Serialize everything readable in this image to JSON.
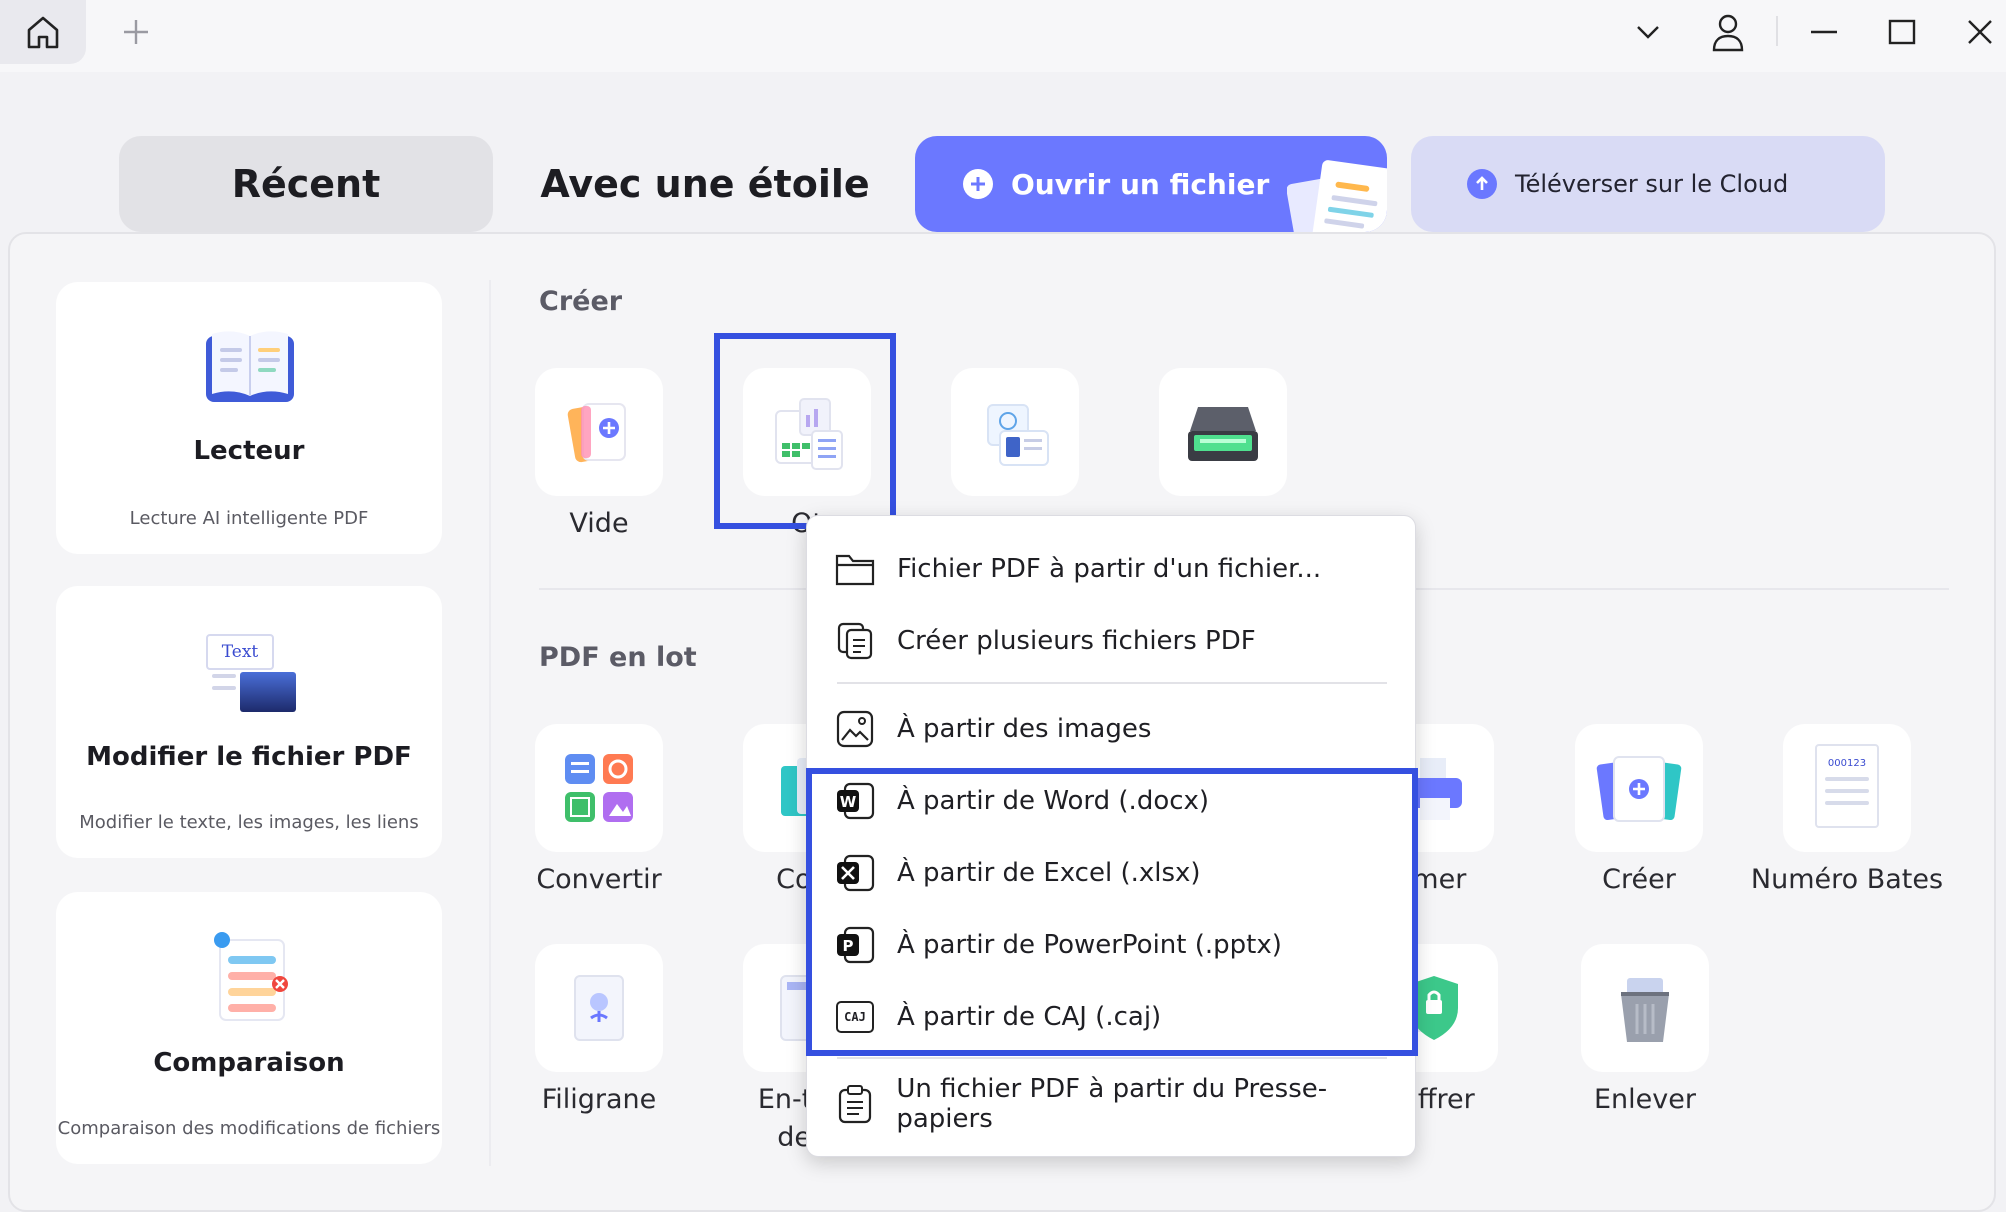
{
  "tabs": {
    "recent": "Récent",
    "starred": "Avec une étoile",
    "open_file": "Ouvrir un fichier",
    "upload_cloud": "Téléverser sur le Cloud"
  },
  "cards": [
    {
      "title": "Lecteur",
      "subtitle": "Lecture AI intelligente PDF"
    },
    {
      "title": "Modifier le fichier PDF",
      "subtitle": "Modifier le texte, les images, les liens"
    },
    {
      "title": "Comparaison",
      "subtitle": "Comparaison des modifications de fichiers"
    }
  ],
  "sections": {
    "create": "Créer",
    "batch": "PDF en lot"
  },
  "create_tools": {
    "blank": "Vide",
    "other_partial": "Ot"
  },
  "batch_tools": {
    "convert": "Convertir",
    "compress_partial": "Com",
    "print_partial": "rimer",
    "create": "Créer",
    "bates": "Numéro Bates",
    "watermark": "Filigrane",
    "header_partial_1": "En-tête",
    "header_partial_2": "de p",
    "encrypt_partial": "hiffrer",
    "remove": "Enlever"
  },
  "edit_icon_text": "Text",
  "bates_icon_text": "000123",
  "menu": {
    "from_file": "Fichier PDF à partir d'un fichier...",
    "multiple": "Créer plusieurs fichiers PDF",
    "from_images": "À partir des images",
    "from_word": "À partir de Word (.docx)",
    "from_excel": "À partir de Excel (.xlsx)",
    "from_ppt": "À partir de PowerPoint (.pptx)",
    "from_caj": "À partir de CAJ (.caj)",
    "from_clipboard": "Un fichier PDF à partir du Presse-papiers",
    "caj_icon_text": "CAJ"
  },
  "colors": {
    "accent": "#6b78ff",
    "highlight": "#3550e0",
    "cloud_tab": "#d9dbf5"
  }
}
